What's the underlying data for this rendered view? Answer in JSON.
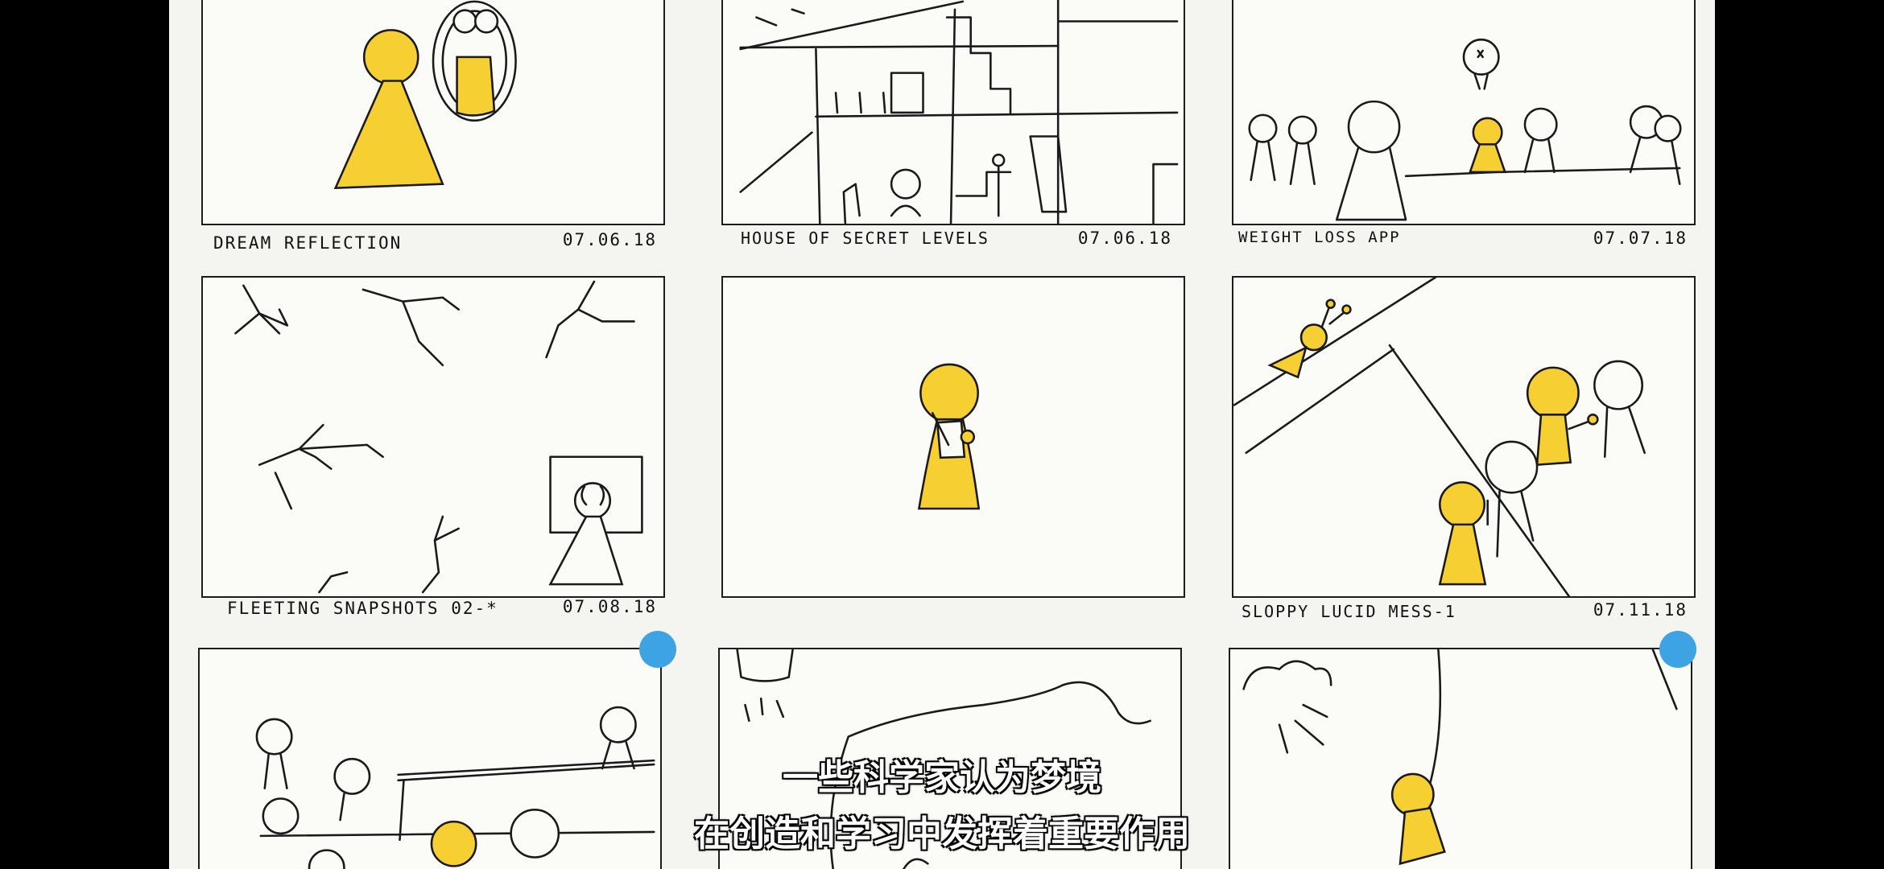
{
  "panels": [
    {
      "caption": "DREAM REFLECTION",
      "date": "07.06.18"
    },
    {
      "caption": "HOUSE OF SECRET LEVELS",
      "date": "07.06.18"
    },
    {
      "caption": "WEIGHT LOSS APP",
      "date": "07.07.18"
    },
    {
      "caption": "FLEETING SNAPSHOTS 02-*",
      "date": "07.08.18"
    },
    {
      "caption": "",
      "date": ""
    },
    {
      "caption": "SLOPPY LUCID MESS-1",
      "date": "07.11.18"
    }
  ],
  "subtitles": {
    "line1": "一些科学家认为梦境",
    "line2": "在创造和学习中发挥着重要作用"
  },
  "colors": {
    "figure_yellow": "#f6cf33",
    "pin_blue": "#3ea3e2",
    "background": "#000000"
  }
}
